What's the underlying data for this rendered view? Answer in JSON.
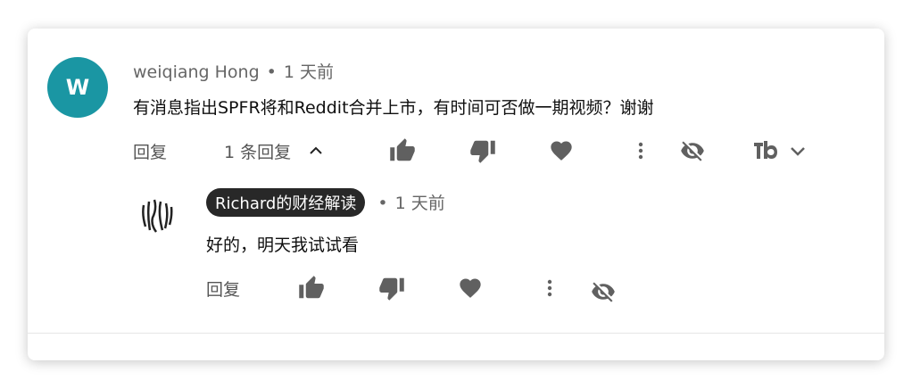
{
  "top_comment": {
    "avatar_letter": "W",
    "author": "weiqiang Hong",
    "separator": "•",
    "time": "1 天前",
    "text": "有消息指出SPFR将和Reddit合并上市，有时间可否做一期视频？谢谢",
    "reply_label": "回复",
    "replies_count_label": "1 条回复",
    "icons": [
      "thumb-up-icon",
      "thumb-down-icon",
      "heart-icon",
      "more-vert-icon",
      "hide-icon",
      "tubebuddy-icon",
      "chevron-down-icon",
      "chevron-up-icon"
    ]
  },
  "reply_comment": {
    "author": "Richard的财经解读",
    "separator": "•",
    "time": "1 天前",
    "text": "好的，明天我试试看",
    "reply_label": "回复"
  },
  "colors": {
    "avatar_bg": "#1a96a3",
    "author_badge_bg": "#282828",
    "icon": "#606060"
  }
}
